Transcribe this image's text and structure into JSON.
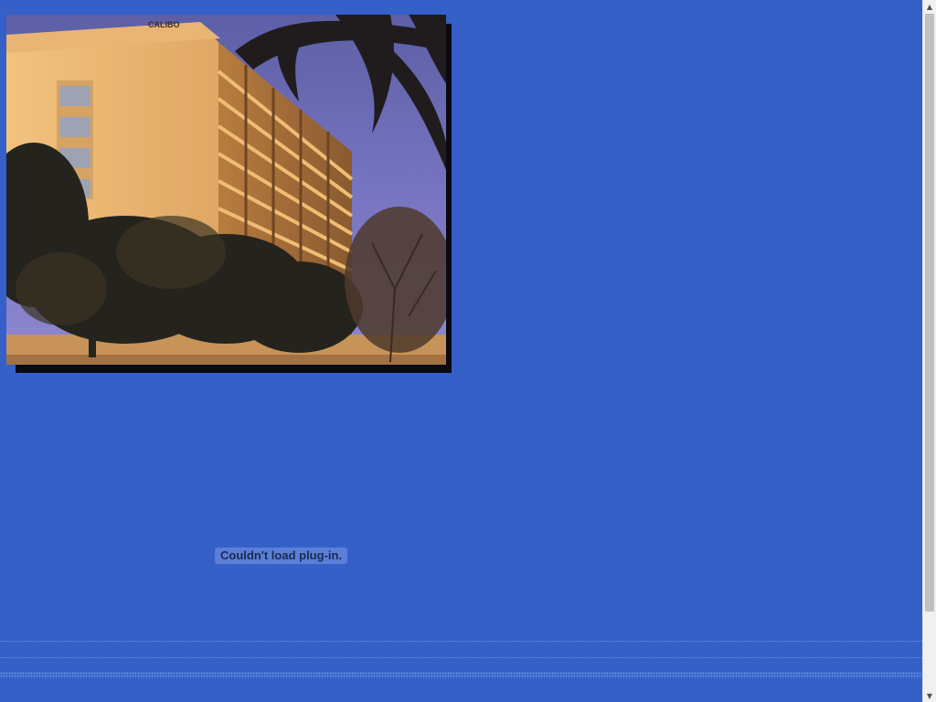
{
  "page": {
    "background_color": "#3460c8"
  },
  "photo": {
    "description_icon": "hotel-building-photo",
    "sign_text": "CALIBO"
  },
  "plugin": {
    "message": "Couldn't load plug-in."
  },
  "scrollbar": {
    "up_icon": "arrow-up-icon",
    "down_icon": "arrow-down-icon",
    "up_glyph": "▲",
    "down_glyph": "▼"
  }
}
